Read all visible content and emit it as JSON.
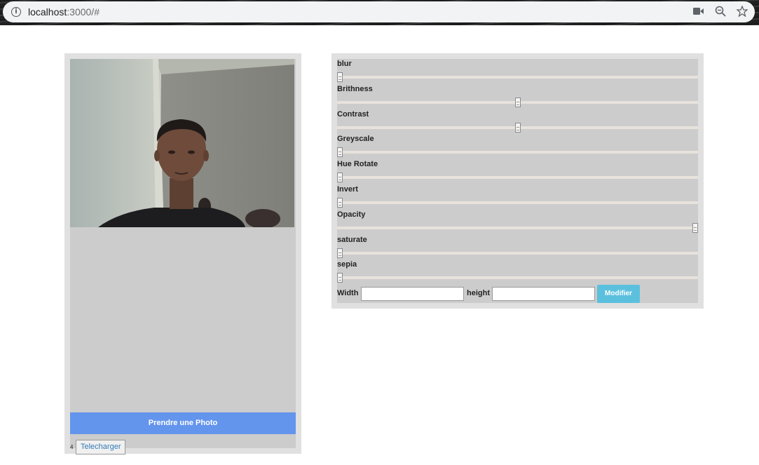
{
  "browser": {
    "url_host": "localhost",
    "url_path": ":3000/#",
    "icons": [
      "info-icon",
      "camera-icon",
      "zoom-icon",
      "bookmark-star-icon"
    ]
  },
  "camera": {
    "take_photo_label": "Prendre une Photo",
    "counter": "4",
    "download_label": "Telecharger"
  },
  "filters": {
    "items": [
      {
        "label": "blur",
        "value_fraction": 0.0
      },
      {
        "label": "Brithness",
        "value_fraction": 0.5
      },
      {
        "label": "Contrast",
        "value_fraction": 0.5
      },
      {
        "label": "Greyscale",
        "value_fraction": 0.0
      },
      {
        "label": "Hue Rotate",
        "value_fraction": 0.0
      },
      {
        "label": "Invert",
        "value_fraction": 0.0
      },
      {
        "label": "Opacity",
        "value_fraction": 1.0
      },
      {
        "label": "saturate",
        "value_fraction": 0.0
      },
      {
        "label": "sepia",
        "value_fraction": 0.0
      }
    ],
    "width_label": "Width",
    "width_value": "",
    "height_label": "height",
    "height_value": "",
    "modify_label": "Modifier"
  },
  "colors": {
    "primary_button": "#6495ed",
    "info_button": "#5bc0de",
    "panel": "#cccccc"
  }
}
